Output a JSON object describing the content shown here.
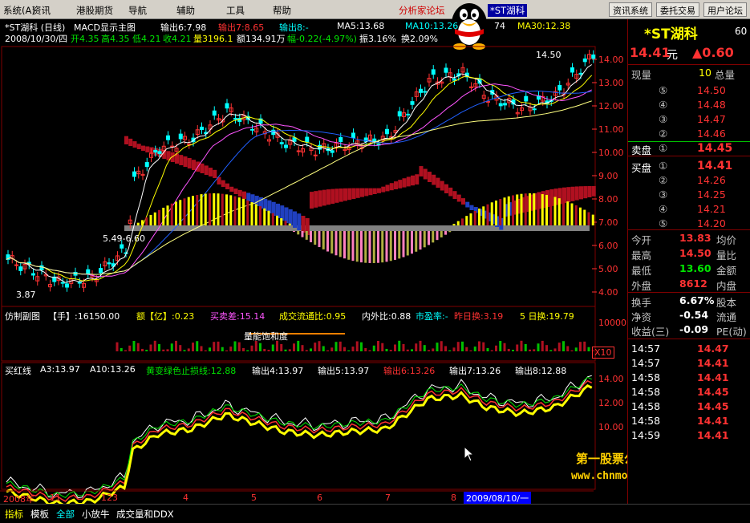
{
  "menu": {
    "items": [
      "系统(A)",
      "资讯",
      "港股期货",
      "导航",
      "辅助",
      "工具",
      "帮助"
    ],
    "center_label": "分析家论坛",
    "stock_tab": "*ST湖科",
    "buttons": [
      "资讯系统",
      "委托交易",
      "用户论坛"
    ]
  },
  "header": {
    "line1": {
      "name": "*ST湖科 (日线)",
      "indicator": "MACD显示主图",
      "out6": "输出6:7.98",
      "out7": "输出7:8.65",
      "out8": "输出8:-",
      "ma5": "MA5:13.68",
      "ma10": "MA10:13.26",
      "num": "74",
      "ma30": "MA30:12.38"
    },
    "line2": {
      "date": "2008/10/30/四",
      "open": "开4.35",
      "high": "高4.35",
      "low": "低4.21",
      "close": "收4.21",
      "vol": "量3196.1",
      "amt": "额134.91万",
      "chg": "幅-0.22(-4.97%)",
      "amp": "振3.16%",
      "turn": "换2.09%"
    }
  },
  "price_axis": [
    "14.00",
    "13.00",
    "12.00",
    "11.00",
    "10.00",
    "9.00",
    "8.00",
    "7.00",
    "6.00",
    "5.00",
    "4.00"
  ],
  "annotations": {
    "high_mark": "14.50",
    "low_mark": "3.87",
    "mid_mark": "5.49-6.60",
    "watermark": "量能饱和度"
  },
  "sub1": {
    "name": "仿制副图",
    "shou": "【手】:16150.00",
    "yi": "额【亿】:0.23",
    "buysell": "买卖差:15.14",
    "flow": "成交流通比:0.95",
    "inout": "内外比:0.88",
    "pe": "市盈率:-",
    "yesterday": "昨日换:3.19",
    "five": "5 日换:19.79",
    "axis": "10000",
    "mult": "X10"
  },
  "sub2": {
    "name": "买红线",
    "a3": "A3:13.97",
    "a10": "A10:13.26",
    "stop": "黄变绿色止损线:12.88",
    "o4": "输出4:13.97",
    "o5": "输出5:13.97",
    "o6": "输出6:13.26",
    "o7": "输出7:13.26",
    "o8": "输出8:12.88",
    "axis": [
      "14.00",
      "12.00",
      "10.00"
    ]
  },
  "date_axis": {
    "labels": [
      "2008年",
      "11",
      "12",
      "3",
      "4",
      "5",
      "6",
      "7",
      "8"
    ],
    "cursor_date": "2009/08/10/一"
  },
  "site": {
    "name": "第一股票公式网",
    "url": "www.chnmoney.com"
  },
  "side": {
    "title": "*ST湖科",
    "code": "60",
    "price": "14.41",
    "unit": "元",
    "change": "▲0.60",
    "vol_now_label": "现量",
    "vol_now": "10",
    "vol_total_label": "总量",
    "sells": [
      {
        "num": "⑤",
        "price": "14.50"
      },
      {
        "num": "④",
        "price": "14.48"
      },
      {
        "num": "③",
        "price": "14.47"
      },
      {
        "num": "②",
        "price": "14.46"
      }
    ],
    "sell1_label": "卖盘",
    "sell1_num": "①",
    "sell1_price": "14.45",
    "buy1_label": "买盘",
    "buy1_num": "①",
    "buy1_price": "14.41",
    "buys": [
      {
        "num": "②",
        "price": "14.26"
      },
      {
        "num": "③",
        "price": "14.25"
      },
      {
        "num": "④",
        "price": "14.21"
      },
      {
        "num": "⑤",
        "price": "14.20"
      }
    ],
    "stats": [
      {
        "l": "今开",
        "v": "13.83",
        "r": "均价",
        "c": "red"
      },
      {
        "l": "最高",
        "v": "14.50",
        "r": "量比",
        "c": "red"
      },
      {
        "l": "最低",
        "v": "13.60",
        "r": "金额",
        "c": "grn"
      },
      {
        "l": "外盘",
        "v": "8612",
        "r": "内盘",
        "c": "red"
      }
    ],
    "stats2": [
      {
        "l": "换手",
        "v": "6.67%",
        "r": "股本"
      },
      {
        "l": "净资",
        "v": "-0.54",
        "r": "流通"
      },
      {
        "l": "收益(三)",
        "v": "-0.09",
        "r": "PE(动)"
      }
    ],
    "ticks": [
      {
        "t": "14:57",
        "p": "14.47"
      },
      {
        "t": "14:57",
        "p": "14.41"
      },
      {
        "t": "14:58",
        "p": "14.41"
      },
      {
        "t": "14:58",
        "p": "14.45"
      },
      {
        "t": "14:58",
        "p": "14.45"
      },
      {
        "t": "14:58",
        "p": "14.41"
      },
      {
        "t": "14:59",
        "p": "14.41"
      }
    ]
  },
  "status": {
    "items": [
      "指标",
      "模板",
      "全部",
      "小放牛",
      "成交量和DDX"
    ]
  }
}
